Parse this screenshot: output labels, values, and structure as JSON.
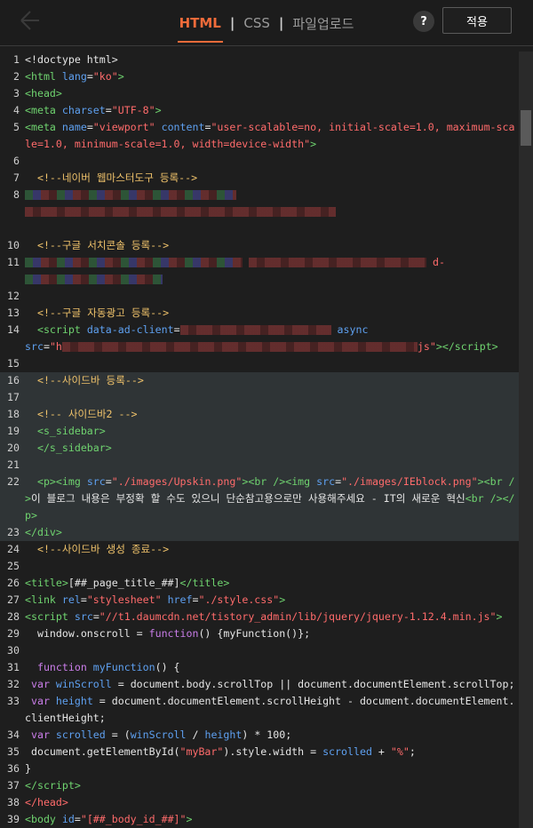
{
  "header": {
    "tabs": [
      "HTML",
      "CSS",
      "파일업로드"
    ],
    "active_tab": "HTML",
    "separator": "|",
    "help_label": "?",
    "apply_label": "적용"
  },
  "editor": {
    "lines": [
      {
        "n": "1",
        "html": "<span class='fn'>&lt;!doctype html&gt;</span>"
      },
      {
        "n": "2",
        "html": "<span class='tag'>&lt;html</span> <span class='attr'>lang</span>=<span class='str'>\"ko\"</span><span class='tag'>&gt;</span>"
      },
      {
        "n": "3",
        "html": "<span class='tag'>&lt;head&gt;</span>"
      },
      {
        "n": "4",
        "html": "<span class='tag'>&lt;meta</span> <span class='attr'>charset</span>=<span class='str'>\"UTF-8\"</span><span class='tag'>&gt;</span>"
      },
      {
        "n": "5",
        "html": "<span class='tag'>&lt;meta</span> <span class='attr'>name</span>=<span class='str'>\"viewport\"</span> <span class='attr'>content</span>=<span class='str'>\"user-scalable=no, initial-scale=1.0, maximum-scale=1.0, minimum-scale=1.0, width=device-width\"</span><span class='tag'>&gt;</span>"
      },
      {
        "n": "6",
        "html": ""
      },
      {
        "n": "7",
        "html": "  <span class='cmt'>&lt;!--네이버 웹마스터도구 등록--&gt;</span>"
      },
      {
        "n": "8",
        "html": "<span class='blur g' style='width:238px'></span><br><span class='blur' style='width:350px'></span>"
      },
      {
        "n": "",
        "html": ""
      },
      {
        "n": "10",
        "html": "  <span class='cmt'>&lt;!--구글 서치콘솔 등록--&gt;</span>"
      },
      {
        "n": "11",
        "html": "<span class='blur g' style='width:245px'></span> <span class='blur' style='width:200px'></span> <span class='str'>d-</span><br><span class='blur g' style='width:155px'></span>"
      },
      {
        "n": "12",
        "html": ""
      },
      {
        "n": "13",
        "html": "  <span class='cmt'>&lt;!--구글 자동광고 등록--&gt;</span>"
      },
      {
        "n": "14",
        "html": "  <span class='tag'>&lt;script</span> <span class='attr'>data-ad-client</span>=<span class='blur' style='width:170px'></span> <span class='attr'>async</span><br><span class='attr'>src</span>=<span class='str'>\"h</span><span class='blur' style='width:400px'></span><span class='str'>js\"</span><span class='tag'>&gt;&lt;/script&gt;</span>"
      },
      {
        "n": "15",
        "html": ""
      },
      {
        "n": "16",
        "html": "  <span class='cmt'>&lt;!--사이드바 등록--&gt;</span>",
        "hl": true
      },
      {
        "n": "17",
        "html": "",
        "hl": true
      },
      {
        "n": "18",
        "html": "  <span class='cmt'>&lt;!-- 사이드바2 --&gt;</span>",
        "hl": true
      },
      {
        "n": "19",
        "html": "  <span class='tag'>&lt;s_sidebar&gt;</span>",
        "hl": true
      },
      {
        "n": "20",
        "html": "  <span class='tag'>&lt;/s_sidebar&gt;</span>",
        "hl": true
      },
      {
        "n": "21",
        "html": "",
        "hl": true
      },
      {
        "n": "22",
        "html": "  <span class='tag'>&lt;p&gt;&lt;img</span> <span class='attr'>src</span>=<span class='str'>\"./images/Upskin.png\"</span><span class='tag'>&gt;&lt;br /&gt;&lt;img</span> <span class='attr'>src</span>=<span class='str'>\"./images/IEblock.png\"</span><span class='tag'>&gt;&lt;br /&gt;</span>이 블로그 내용은 부정확 할 수도 있으니 단순참고용으로만 사용해주세요 - IT의 새로운 혁신<span class='tag'>&lt;br /&gt;&lt;/p&gt;</span>",
        "hl": true
      },
      {
        "n": "23",
        "html": "<span class='tag'>&lt;/div&gt;</span>",
        "hl": true
      },
      {
        "n": "24",
        "html": "  <span class='cmt'>&lt;!--사이드바 생성 종료--&gt;</span>"
      },
      {
        "n": "25",
        "html": ""
      },
      {
        "n": "26",
        "html": "<span class='tag'>&lt;title&gt;</span>[##_page_title_##]<span class='tag'>&lt;/title&gt;</span>"
      },
      {
        "n": "27",
        "html": "<span class='tag'>&lt;link</span> <span class='attr'>rel</span>=<span class='str'>\"stylesheet\"</span> <span class='attr'>href</span>=<span class='str'>\"./style.css\"</span><span class='tag'>&gt;</span>"
      },
      {
        "n": "28",
        "html": "<span class='tag'>&lt;script</span> <span class='attr'>src</span>=<span class='str'>\"//t1.daumcdn.net/tistory_admin/lib/jquery/jquery-1.12.4.min.js\"</span><span class='tag'>&gt;</span>"
      },
      {
        "n": "29",
        "html": "  window.onscroll = <span class='kw'>function</span>() {myFunction()};"
      },
      {
        "n": "30",
        "html": ""
      },
      {
        "n": "31",
        "html": "  <span class='kw'>function</span> <span class='attr'>myFunction</span>() {"
      },
      {
        "n": "32",
        "html": " <span class='kw'>var</span> <span class='attr'>winScroll</span> = document.body.scrollTop || document.documentElement.scrollTop;"
      },
      {
        "n": "33",
        "html": " <span class='kw'>var</span> <span class='attr'>height</span> = document.documentElement.scrollHeight - document.documentElement.clientHeight;"
      },
      {
        "n": "34",
        "html": " <span class='kw'>var</span> <span class='attr'>scrolled</span> = (<span class='attr'>winScroll</span> / <span class='attr'>height</span>) * 100;"
      },
      {
        "n": "35",
        "html": " document.getElementById(<span class='str'>\"myBar\"</span>).style.width = <span class='attr'>scrolled</span> + <span class='str'>\"%\"</span>;"
      },
      {
        "n": "36",
        "html": "}"
      },
      {
        "n": "37",
        "html": "<span class='tag'>&lt;/script&gt;</span>"
      },
      {
        "n": "38",
        "html": "<span class='str'>&lt;/head&gt;</span>"
      },
      {
        "n": "39",
        "html": "<span class='tag'>&lt;body</span> <span class='attr'>id</span>=<span class='str'>\"[##_body_id_##]\"</span><span class='tag'>&gt;</span>"
      }
    ]
  }
}
